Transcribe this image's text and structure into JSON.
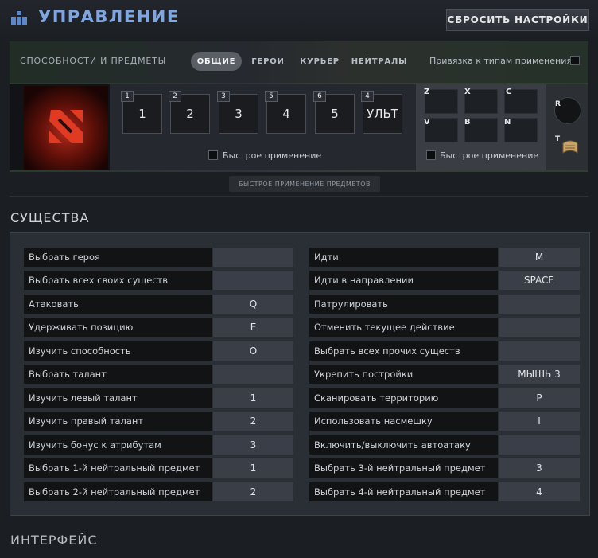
{
  "header": {
    "title": "УПРАВЛЕНИЕ",
    "reset_label": "СБРОСИТЬ НАСТРОЙКИ"
  },
  "abilities": {
    "section_label": "СПОСОБНОСТИ И ПРЕДМЕТЫ",
    "tabs": [
      {
        "label": "ОБЩИЕ",
        "active": true
      },
      {
        "label": "ГЕРОИ",
        "active": false
      },
      {
        "label": "КУРЬЕР",
        "active": false
      },
      {
        "label": "НЕЙТРАЛЫ",
        "active": false
      }
    ],
    "binding_label": "Привязка к типам применения",
    "slots": [
      {
        "badge": "1",
        "key": "1"
      },
      {
        "badge": "2",
        "key": "2"
      },
      {
        "badge": "3",
        "key": "3"
      },
      {
        "badge": "5",
        "key": "4"
      },
      {
        "badge": "6",
        "key": "5"
      },
      {
        "badge": "4",
        "key": "УЛЬТ"
      }
    ],
    "quickcast_label": "Быстрое применение",
    "item_keys": [
      "Z",
      "X",
      "C",
      "V",
      "B",
      "N"
    ],
    "items_quickcast_label": "Быстрое применение",
    "tp_key": "R",
    "scroll_key": "T",
    "quick_items_button": "БЫСТРОЕ ПРИМЕНЕНИЕ ПРЕДМЕТОВ"
  },
  "units": {
    "title": "СУЩЕСТВА",
    "left": [
      {
        "label": "Выбрать героя",
        "key": ""
      },
      {
        "label": "Выбрать всех своих существ",
        "key": ""
      },
      {
        "label": "Атаковать",
        "key": "Q"
      },
      {
        "label": "Удерживать позицию",
        "key": "E"
      },
      {
        "label": "Изучить способность",
        "key": "O"
      },
      {
        "label": "Выбрать талант",
        "key": ""
      },
      {
        "label": "Изучить левый талант",
        "key": "1"
      },
      {
        "label": "Изучить правый талант",
        "key": "2"
      },
      {
        "label": "Изучить бонус к атрибутам",
        "key": "3"
      },
      {
        "label": "Выбрать 1-й нейтральный предмет",
        "key": "1"
      },
      {
        "label": "Выбрать 2-й нейтральный предмет",
        "key": "2"
      }
    ],
    "right": [
      {
        "label": "Идти",
        "key": "M"
      },
      {
        "label": "Идти в направлении",
        "key": "SPACE"
      },
      {
        "label": "Патрулировать",
        "key": ""
      },
      {
        "label": "Отменить текущее действие",
        "key": ""
      },
      {
        "label": "Выбрать всех прочих существ",
        "key": ""
      },
      {
        "label": "Укрепить постройки",
        "key": "МЫШЬ 3"
      },
      {
        "label": "Сканировать территорию",
        "key": "P"
      },
      {
        "label": "Использовать насмешку",
        "key": "I"
      },
      {
        "label": "Включить/выключить автоатаку",
        "key": ""
      },
      {
        "label": "Выбрать 3-й нейтральный предмет",
        "key": "3"
      },
      {
        "label": "Выбрать 4-й нейтральный предмет",
        "key": "4"
      }
    ]
  },
  "interface": {
    "title": "ИНТЕРФЕЙС"
  }
}
